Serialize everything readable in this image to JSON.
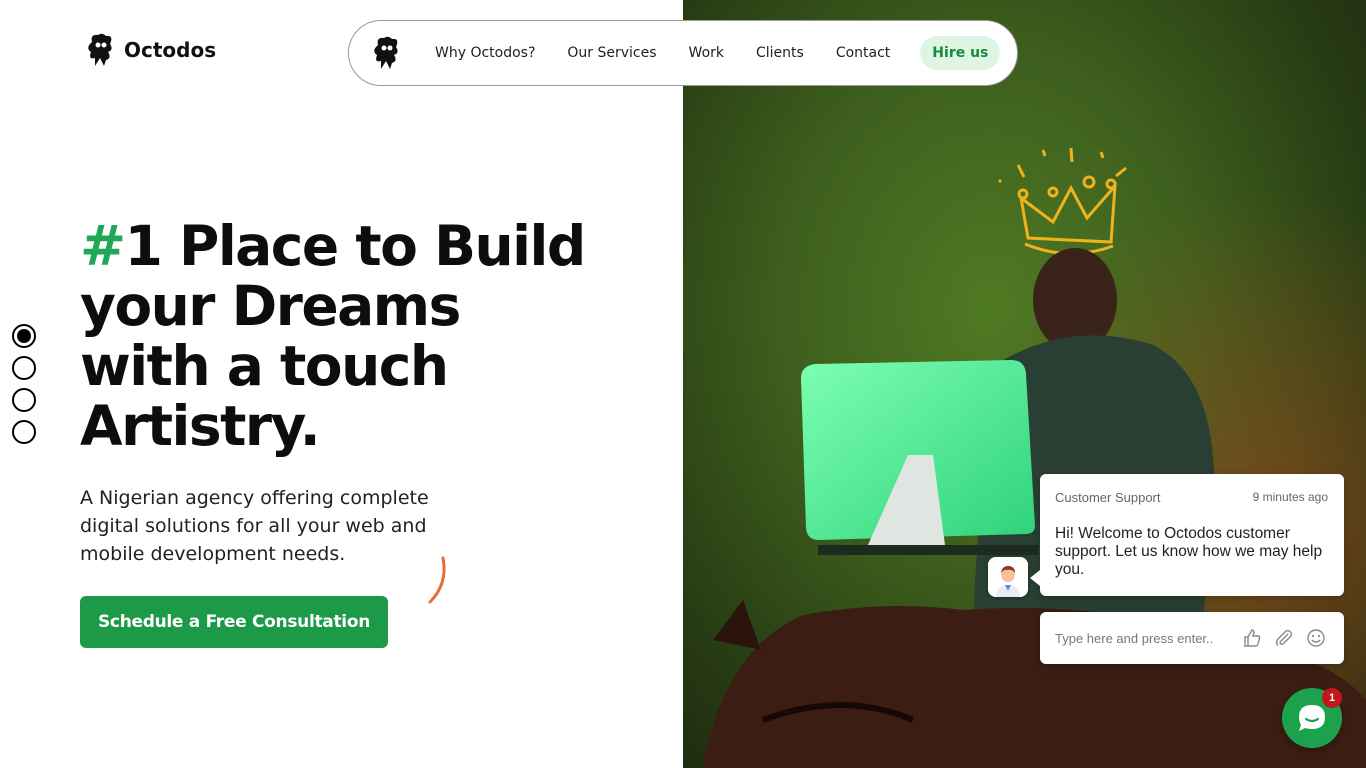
{
  "brand": {
    "name": "Octodos"
  },
  "nav": {
    "items": [
      {
        "label": "Why Octodos?"
      },
      {
        "label": "Our Services"
      },
      {
        "label": "Work"
      },
      {
        "label": "Clients"
      },
      {
        "label": "Contact"
      }
    ],
    "hire_label": "Hire us"
  },
  "slider": {
    "count": 4,
    "active": 1
  },
  "hero": {
    "headline_hash": "#",
    "headline_line1": "1 Place to Build",
    "headline_line2": "your Dreams",
    "headline_line3": "with a touch",
    "headline_line4": "Artistry.",
    "subtext": "A Nigerian agency offering complete digital solutions for all your web and mobile development needs.",
    "cta_label": "Schedule a Free Consultation"
  },
  "chat": {
    "agent": "Customer Support",
    "time": "9 minutes ago",
    "message": "Hi! Welcome to Octodos customer support. Let us know how we may help you.",
    "input_placeholder": "Type here and press enter..",
    "unread_count": "1"
  },
  "colors": {
    "accent_green": "#1fa855",
    "cta_green": "#1c9a48",
    "hire_bg": "#dff5e3",
    "badge_red": "#c3171d"
  },
  "icons": {
    "logo": "octopus-mascot-icon",
    "like": "thumbs-up-icon",
    "attach": "paperclip-icon",
    "emoji": "smiley-icon",
    "launcher": "chat-bubble-icon"
  }
}
